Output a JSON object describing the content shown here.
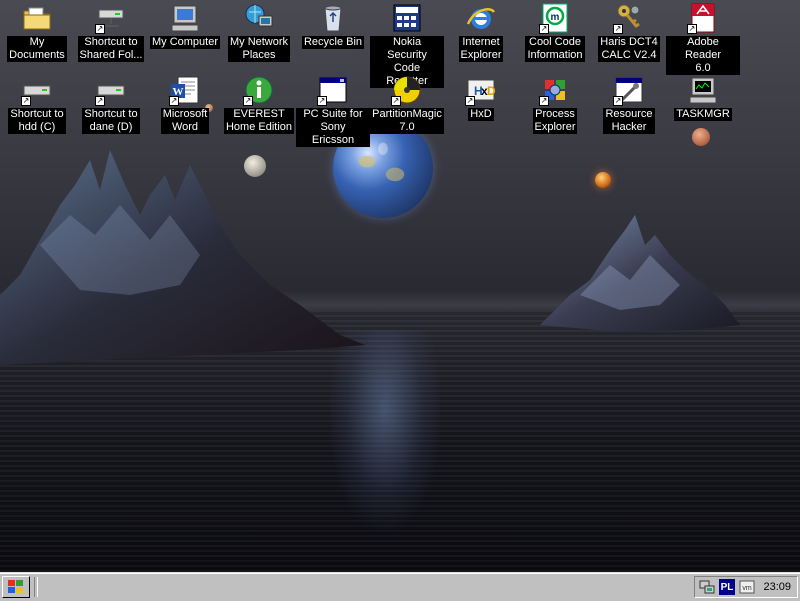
{
  "desktop": {
    "icons": [
      {
        "label": "My\nDocuments",
        "icon": "folder-documents-icon",
        "shortcut": false
      },
      {
        "label": "Shortcut to\nShared Fol...",
        "icon": "network-drive-icon",
        "shortcut": true
      },
      {
        "label": "My Computer",
        "icon": "computer-icon",
        "shortcut": false
      },
      {
        "label": "My Network\nPlaces",
        "icon": "network-places-icon",
        "shortcut": false
      },
      {
        "label": "Recycle Bin",
        "icon": "recycle-bin-icon",
        "shortcut": false
      },
      {
        "label": "Nokia Security\nCode Resetter",
        "icon": "nokia-app-icon",
        "shortcut": false
      },
      {
        "label": "Internet\nExplorer",
        "icon": "internet-explorer-icon",
        "shortcut": false
      },
      {
        "label": "Cool Code\nInformation",
        "icon": "cool-code-icon",
        "shortcut": true
      },
      {
        "label": "Haris DCT4\nCALC V2.4",
        "icon": "keys-icon",
        "shortcut": true
      },
      {
        "label": "Adobe Reader\n6.0",
        "icon": "adobe-reader-icon",
        "shortcut": true
      },
      {
        "label": "Shortcut to\nhdd (C)",
        "icon": "hard-drive-icon",
        "shortcut": true
      },
      {
        "label": "Shortcut to\ndane (D)",
        "icon": "hard-drive-icon",
        "shortcut": true
      },
      {
        "label": "Microsoft\nWord",
        "icon": "word-icon",
        "shortcut": true
      },
      {
        "label": "EVEREST\nHome Edition",
        "icon": "everest-info-icon",
        "shortcut": true
      },
      {
        "label": "PC Suite for\nSony Ericsson",
        "icon": "window-app-icon",
        "shortcut": true
      },
      {
        "label": "PartitionMagic\n7.0",
        "icon": "partition-magic-icon",
        "shortcut": true
      },
      {
        "label": "HxD",
        "icon": "hxd-icon",
        "shortcut": true
      },
      {
        "label": "Process\nExplorer",
        "icon": "process-explorer-icon",
        "shortcut": true
      },
      {
        "label": "Resource\nHacker",
        "icon": "resource-hacker-icon",
        "shortcut": true
      },
      {
        "label": "TASKMGR",
        "icon": "task-manager-icon",
        "shortcut": false
      }
    ]
  },
  "taskbar": {
    "start_icon": "windows-logo-icon",
    "tray": {
      "icons": [
        "network-tray-icon",
        "language-indicator",
        "vmware-tray-icon"
      ],
      "language": "PL",
      "vm_label": "vm",
      "clock": "23:09"
    }
  },
  "colors": {
    "taskbar": "#c0c0c0",
    "label_bg": "#000000",
    "label_fg": "#ffffff",
    "lang_bg": "#00008a"
  }
}
